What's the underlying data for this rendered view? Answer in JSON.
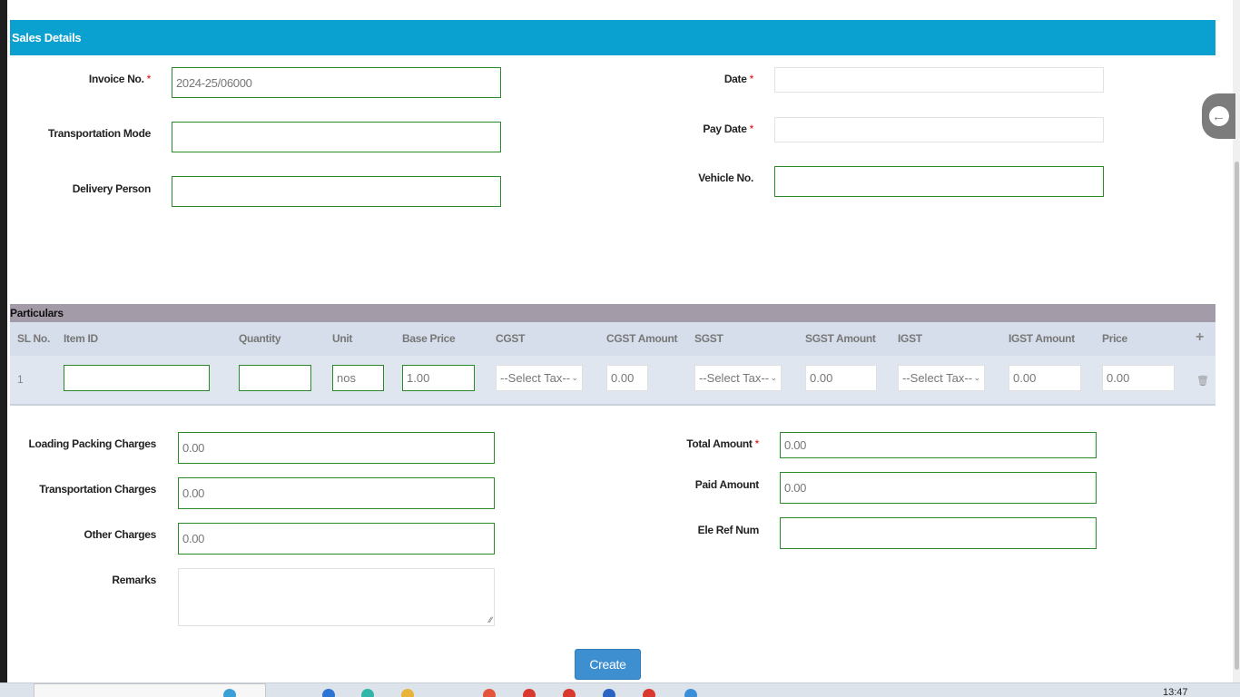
{
  "section": {
    "title": "Sales Details"
  },
  "fields": {
    "invoice_label": "Invoice No.",
    "invoice_value": "2024-25/06000",
    "transport_mode_label": "Transportation Mode",
    "delivery_person_label": "Delivery Person",
    "date_label": "Date",
    "pay_date_label": "Pay Date",
    "vehicle_label": "Vehicle No.",
    "required_mark": "*"
  },
  "particulars": {
    "title": "Particulars",
    "columns": [
      "SL No.",
      "Item ID",
      "Quantity",
      "Unit",
      "Base Price",
      "CGST",
      "CGST Amount",
      "SGST",
      "SGST Amount",
      "IGST",
      "IGST Amount",
      "Price"
    ],
    "add_icon": "plus-icon",
    "row": {
      "sl": "1",
      "item_id": "",
      "quantity": "",
      "unit": "nos",
      "base_price": "1.00",
      "cgst": "--Select Tax--",
      "cgst_amount": "0.00",
      "sgst": "--Select Tax--",
      "sgst_amount": "0.00",
      "igst": "--Select Tax--",
      "igst_amount": "0.00",
      "price": "0.00",
      "delete_icon": "trash-icon"
    }
  },
  "charges": {
    "loading_label": "Loading Packing Charges",
    "loading_value": "0.00",
    "transport_label": "Transportation Charges",
    "transport_value": "0.00",
    "other_label": "Other Charges",
    "other_value": "0.00",
    "remarks_label": "Remarks"
  },
  "totals": {
    "total_label": "Total Amount",
    "total_value": "0.00",
    "paid_label": "Paid Amount",
    "paid_value": "0.00",
    "ele_ref_label": "Ele Ref Num"
  },
  "actions": {
    "create_label": "Create",
    "back_icon": "arrow-left-icon"
  },
  "taskbar": {
    "time": "13:47"
  },
  "colors": {
    "header": "#0aa0cf",
    "particulars_bar": "#a49ba9",
    "input_border": "#2a8a2a",
    "button": "#3d8fd0"
  }
}
